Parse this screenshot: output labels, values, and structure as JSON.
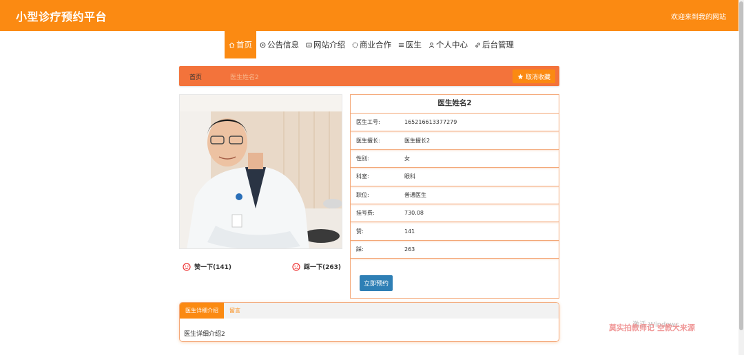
{
  "header": {
    "title": "小型诊疗预约平台",
    "welcome": "欢迎来到我的网站"
  },
  "nav": {
    "items": [
      {
        "label": "首页",
        "icon": "home-icon",
        "active": true
      },
      {
        "label": "公告信息",
        "icon": "announcement-icon",
        "active": false
      },
      {
        "label": "网站介绍",
        "icon": "info-icon",
        "active": false
      },
      {
        "label": "商业合作",
        "icon": "cooperation-icon",
        "active": false
      },
      {
        "label": "医生",
        "icon": "doctor-icon",
        "active": false
      },
      {
        "label": "个人中心",
        "icon": "user-icon",
        "active": false
      },
      {
        "label": "后台管理",
        "icon": "link-icon",
        "active": false
      }
    ]
  },
  "breadcrumb": {
    "home": "首页",
    "current": "医生姓名2",
    "fav_label": "取消收藏"
  },
  "doctor": {
    "name": "医生姓名2",
    "fields": [
      {
        "label": "医生工号:",
        "value": "1652166133772​79"
      },
      {
        "label": "医生擅长:",
        "value": "医生擅长2"
      },
      {
        "label": "性别:",
        "value": "女"
      },
      {
        "label": "科室:",
        "value": "眼科"
      },
      {
        "label": "职位:",
        "value": "普通医生"
      },
      {
        "label": "挂号费:",
        "value": "730.08"
      },
      {
        "label": "赞:",
        "value": "141"
      },
      {
        "label": "踩:",
        "value": "263"
      }
    ],
    "book_label": "立即预约",
    "like_label": "赞一下(141)",
    "dislike_label": "踩一下(263)"
  },
  "tabs": {
    "items": [
      {
        "label": "医生详细介绍",
        "active": true
      },
      {
        "label": "留言",
        "active": false
      }
    ],
    "content": "医生详细介绍2"
  },
  "watermark": {
    "line1": "激活 Windows",
    "line2": "莫实拍教师记 空教大来源"
  },
  "colors": {
    "brand": "#fb8a12",
    "crumb": "#f3733b",
    "border": "#f4a878",
    "button": "#2e7fb5"
  }
}
